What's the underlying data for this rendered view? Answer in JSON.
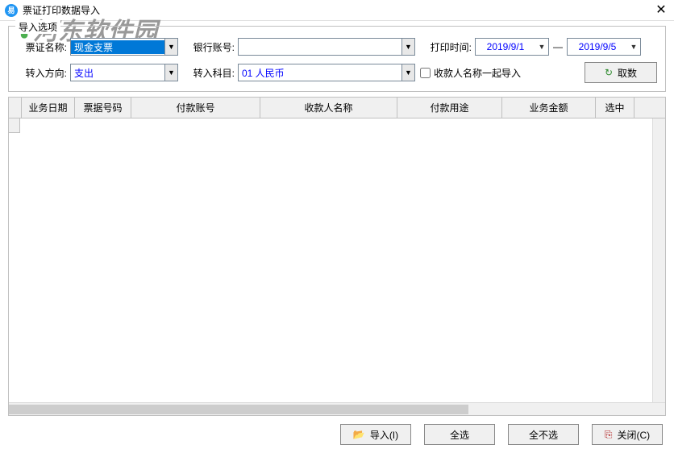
{
  "window": {
    "title": "票证打印数据导入",
    "app_icon_text": "易"
  },
  "options": {
    "legend": "导入选项",
    "cert_name_label": "票证名称:",
    "cert_name_value": "现金支票",
    "bank_acct_label": "银行账号:",
    "bank_acct_value": "",
    "print_time_label": "打印时间:",
    "date_from": "2019/9/1",
    "date_sep": "—",
    "date_to": "2019/9/5",
    "direction_label": "转入方向:",
    "direction_value": "支出",
    "subject_label": "转入科目:",
    "subject_value": "01 人民币",
    "checkbox_label": "收款人名称一起导入",
    "fetch_button": "取数"
  },
  "table": {
    "columns": [
      "业务日期",
      "票据号码",
      "付款账号",
      "收款人名称",
      "付款用途",
      "业务金额",
      "选中"
    ]
  },
  "footer": {
    "import_btn": "导入(I)",
    "select_all_btn": "全选",
    "select_none_btn": "全不选",
    "close_btn": "关闭(C)"
  },
  "watermark": "河东软件园"
}
